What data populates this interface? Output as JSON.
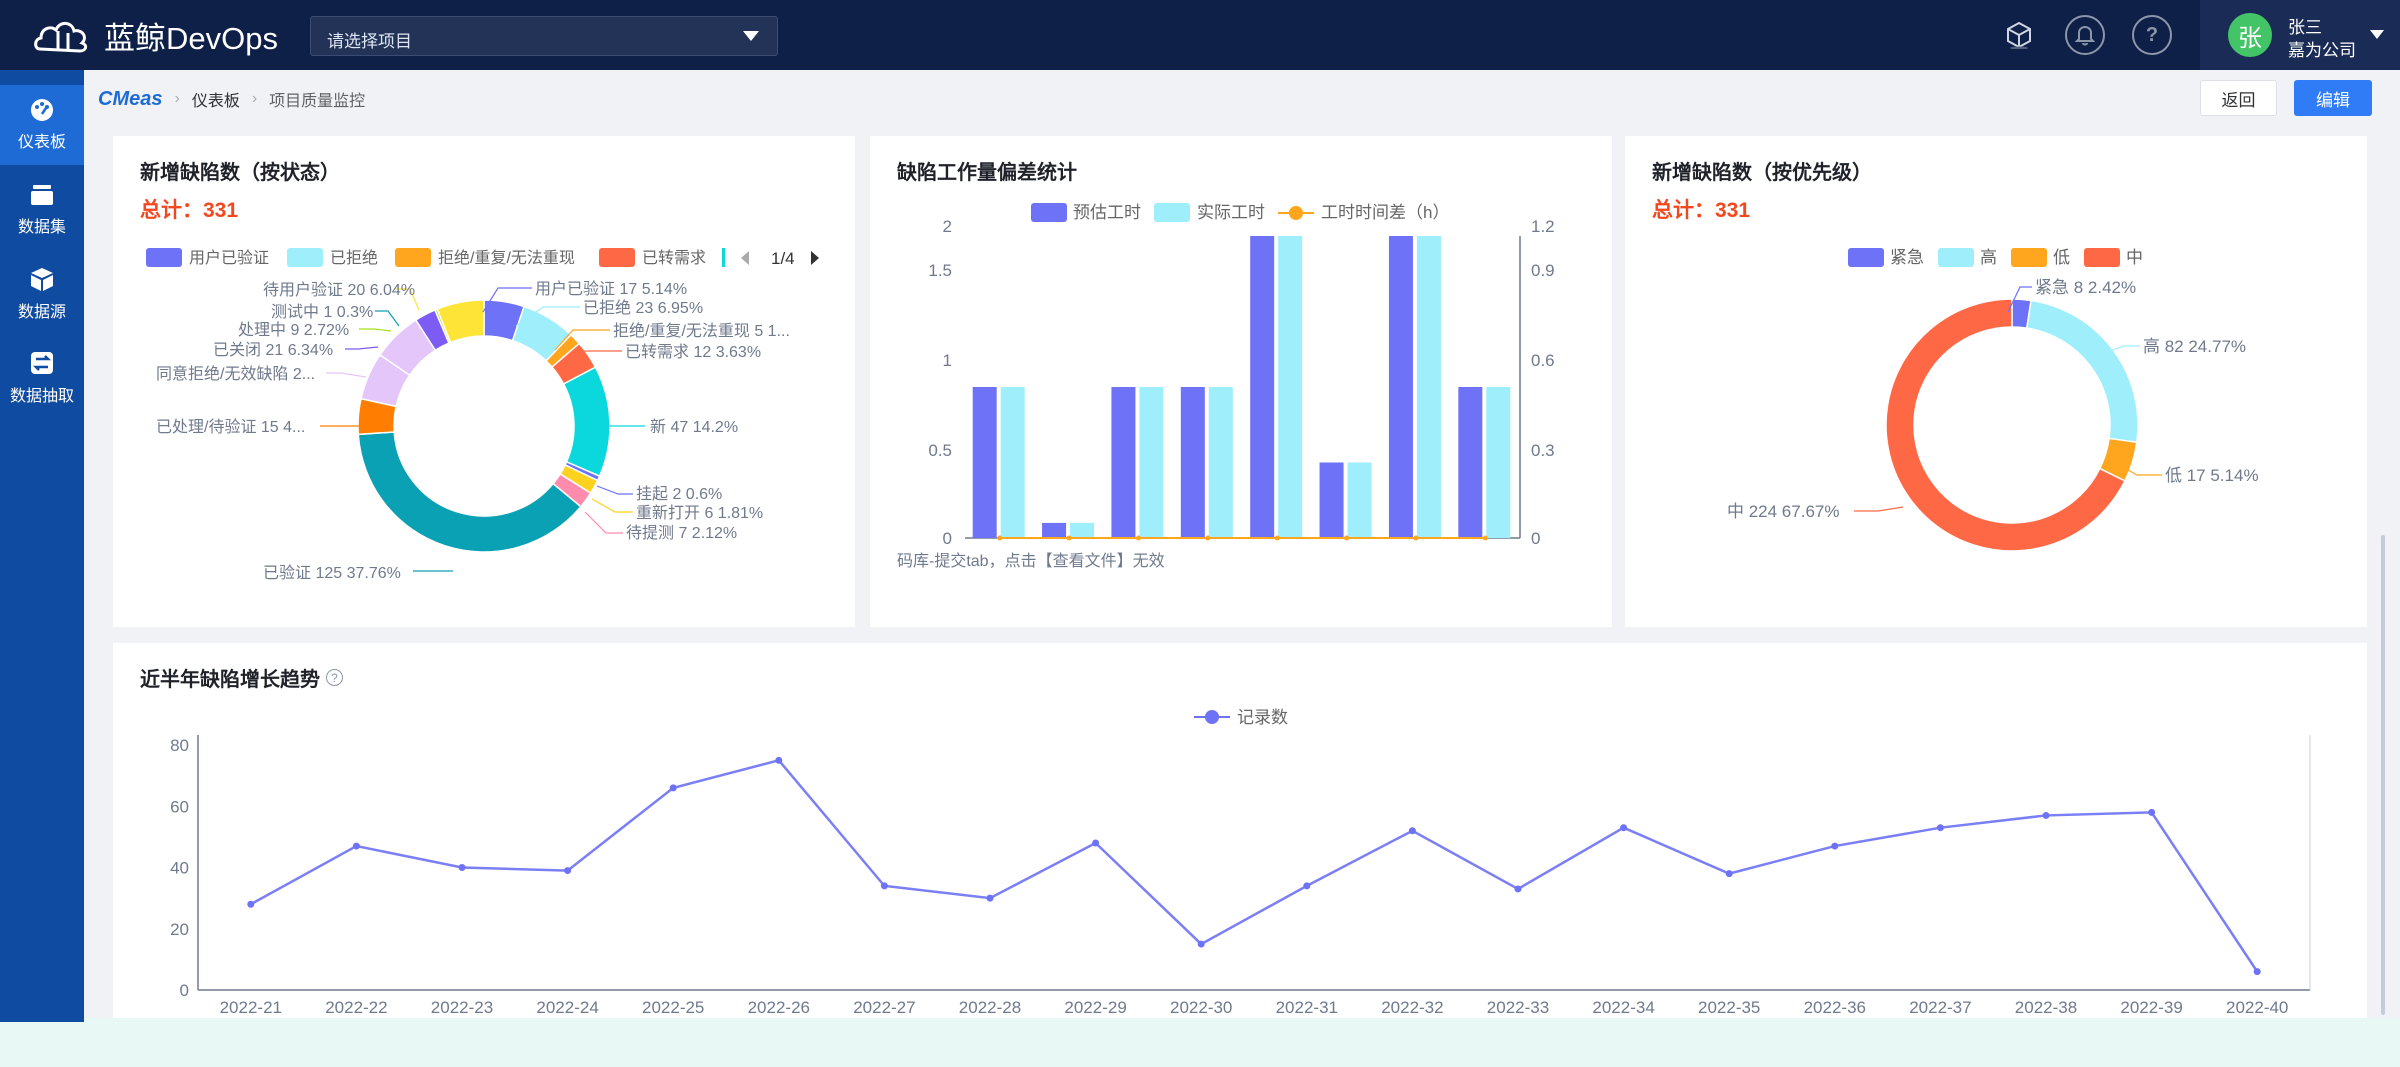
{
  "app": {
    "name": "蓝鲸DevOps"
  },
  "topbar": {
    "project_placeholder": "请选择项目"
  },
  "user": {
    "avatar_char": "张",
    "name": "张三",
    "company": "嘉为公司"
  },
  "sidebar": {
    "items": [
      {
        "label": "仪表板",
        "icon": "dashboard-icon",
        "active": true
      },
      {
        "label": "数据集",
        "icon": "dataset-icon"
      },
      {
        "label": "数据源",
        "icon": "datasource-icon"
      },
      {
        "label": "数据抽取",
        "icon": "extract-icon"
      }
    ]
  },
  "breadcrumb": {
    "brand": "CMeas",
    "items": [
      "仪表板",
      "项目质量监控"
    ]
  },
  "actions": {
    "back": "返回",
    "edit": "编辑"
  },
  "colors": {
    "accent": "#2f7cf6",
    "total": "#f3481f",
    "series": [
      "#6e72f7",
      "#9eeefb",
      "#ffa51e",
      "#ff6845",
      "#0ad8dc",
      "#ff8bad",
      "#ffd21f",
      "#a4e01b",
      "#7d5cf5",
      "#e4c6fa",
      "#ff7d00",
      "#0aa1b5"
    ]
  },
  "charts": {
    "status_pie": {
      "title": "新增缺陷数（按状态）",
      "total_label": "总计：331",
      "legend": [
        "用户已验证",
        "已拒绝",
        "拒绝/重复/无法重现",
        "已转需求"
      ],
      "legend_page": "1/4",
      "labels": [
        "用户已验证 17 5.14%",
        "已拒绝 23 6.95%",
        "拒绝/重复/无法重现 5 1...",
        "已转需求 12 3.63%",
        "新 47 14.2%",
        "挂起 2 0.6%",
        "重新打开 6 1.81%",
        "待提测 7 2.12%",
        "已验证 125 37.76%",
        "已处理/待验证 15 4...",
        "同意拒绝/无效缺陷 2...",
        "已关闭 21 6.34%",
        "处理中 9 2.72%",
        "测试中 1 0.3%",
        "待用户验证 20 6.04%"
      ]
    },
    "workload_bar": {
      "title": "缺陷工作量偏差统计",
      "legend": [
        "预估工时",
        "实际工时",
        "工时时间差（h）"
      ],
      "yleft_ticks": [
        "0",
        "0.5",
        "1",
        "1.5",
        "2"
      ],
      "yright_ticks": [
        "0",
        "0.3",
        "0.6",
        "0.9",
        "1.2"
      ],
      "xlabel_visible": "码库-提交tab，点击【查看文件】无效"
    },
    "priority_pie": {
      "title": "新增缺陷数（按优先级）",
      "total_label": "总计：331",
      "legend": [
        "紧急",
        "高",
        "低",
        "中"
      ],
      "labels": [
        "紧急 8 2.42%",
        "高 82 24.77%",
        "低 17 5.14%",
        "中 224 67.67%"
      ]
    },
    "trend_line": {
      "title": "近半年缺陷增长趋势",
      "legend": [
        "记录数"
      ],
      "y_ticks": [
        "0",
        "20",
        "40",
        "60",
        "80"
      ]
    }
  },
  "chart_data": [
    {
      "type": "pie",
      "title": "新增缺陷数（按状态）",
      "labels": [
        "用户已验证",
        "已拒绝",
        "拒绝/重复/无法重现",
        "已转需求",
        "新",
        "挂起",
        "重新打开",
        "待提测",
        "已验证",
        "已处理/待验证",
        "同意拒绝/无效缺陷",
        "已关闭",
        "处理中",
        "测试中",
        "待用户验证"
      ],
      "values": [
        17,
        23,
        5,
        12,
        47,
        2,
        6,
        7,
        125,
        15,
        20,
        21,
        9,
        1,
        20
      ],
      "colors": [
        "#6e72f7",
        "#9eeefb",
        "#ffa51e",
        "#ff6845",
        "#0ad8dc",
        "#6e72f7",
        "#ffd21f",
        "#ff8bad",
        "#0aa1b5",
        "#ff7d00",
        "#e4c6fa",
        "#e4c6fa",
        "#7d5cf5",
        "#a4e01b",
        "#ffe438"
      ]
    },
    {
      "type": "bar",
      "title": "缺陷工作量偏差统计",
      "series": [
        {
          "name": "预估工时",
          "values": [
            1,
            0.1,
            1,
            1,
            2,
            0.5,
            2,
            1
          ]
        },
        {
          "name": "实际工时",
          "values": [
            1,
            0.1,
            1,
            1,
            2,
            0.5,
            2,
            1
          ]
        },
        {
          "name": "工时时间差（h）",
          "values": [
            0,
            0,
            0,
            0,
            0,
            0,
            0,
            0
          ]
        }
      ],
      "ylim": [
        0,
        2
      ],
      "y2lim": [
        0,
        1.2
      ]
    },
    {
      "type": "pie",
      "title": "新增缺陷数（按优先级）",
      "labels": [
        "紧急",
        "高",
        "低",
        "中"
      ],
      "values": [
        8,
        82,
        17,
        224
      ],
      "colors": [
        "#6e72f7",
        "#9eeefb",
        "#ffa51e",
        "#ff6845"
      ]
    },
    {
      "type": "line",
      "title": "近半年缺陷增长趋势",
      "categories": [
        "2022-21",
        "2022-22",
        "2022-23",
        "2022-24",
        "2022-25",
        "2022-26",
        "2022-27",
        "2022-28",
        "2022-29",
        "2022-30",
        "2022-31",
        "2022-32",
        "2022-33",
        "2022-34",
        "2022-35",
        "2022-36",
        "2022-37",
        "2022-38",
        "2022-39",
        "2022-40"
      ],
      "series": [
        {
          "name": "记录数",
          "values": [
            28,
            47,
            40,
            39,
            66,
            75,
            34,
            30,
            48,
            15,
            34,
            52,
            33,
            53,
            38,
            47,
            53,
            57,
            58,
            6
          ]
        }
      ],
      "ylim": [
        0,
        80
      ]
    }
  ]
}
